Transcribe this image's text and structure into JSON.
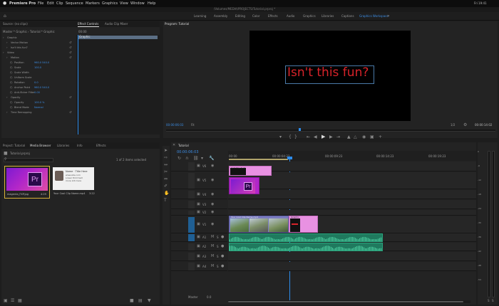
{
  "menubar": {
    "app_name": "Premiere Pro",
    "items": [
      "File",
      "Edit",
      "Clip",
      "Sequence",
      "Markers",
      "Graphics",
      "View",
      "Window",
      "Help"
    ],
    "status": "Fri 19:41"
  },
  "title_bar": {
    "path": "/Volumes/MEDIA/PROJECTS/Tutorial.prproj *"
  },
  "workspaces": [
    "Learning",
    "Assembly",
    "Editing",
    "Color",
    "Effects",
    "Audio",
    "Graphics",
    "Libraries",
    "Captions",
    "Graphics Workspace"
  ],
  "source_tabs": [
    "Source: (no clips)",
    "Effect Controls",
    "Audio Clip Mixer"
  ],
  "effect_controls": {
    "header": "Master * Graphic  ›  Tutorial * Graphic",
    "ruler_time": "00:00",
    "clip_bar": "Graphic",
    "rows": [
      {
        "label": "Graphic",
        "indent": 0,
        "value": ""
      },
      {
        "label": "Vector Motion",
        "indent": 1,
        "value": ""
      },
      {
        "label": "Isn't this fun?",
        "indent": 1,
        "value": ""
      },
      {
        "label": "Video",
        "indent": 0,
        "value": ""
      },
      {
        "label": "Motion",
        "indent": 1,
        "value": ""
      },
      {
        "label": "Position",
        "indent": 2,
        "value": "960.0   540.0"
      },
      {
        "label": "Scale",
        "indent": 2,
        "value": "100.0"
      },
      {
        "label": "Scale Width",
        "indent": 2,
        "value": ""
      },
      {
        "label": "Uniform Scale",
        "indent": 2,
        "value": ""
      },
      {
        "label": "Rotation",
        "indent": 2,
        "value": "0.0"
      },
      {
        "label": "Anchor Point",
        "indent": 2,
        "value": "960.0   540.0"
      },
      {
        "label": "Anti-flicker Filter",
        "indent": 2,
        "value": "0.00"
      },
      {
        "label": "Opacity",
        "indent": 1,
        "value": ""
      },
      {
        "label": "Opacity",
        "indent": 2,
        "value": "100.0 %"
      },
      {
        "label": "Blend Mode",
        "indent": 2,
        "value": "Normal"
      },
      {
        "label": "Time Remapping",
        "indent": 1,
        "value": ""
      }
    ],
    "timecode": "00:00:06:03"
  },
  "program": {
    "tab": "Program: Tutorial",
    "overlay_text": "Isn't this fun?",
    "timecode": "00:00:06:03",
    "fit": "Fit",
    "quality": "1/2",
    "duration": "00:00:14:02"
  },
  "project": {
    "tabs": [
      "Project: Tutorial",
      "Media Browser",
      "Libraries",
      "Info",
      "Effects"
    ],
    "bin": "Tutorial.prproj",
    "count": "1 of 2 items selected",
    "items": [
      {
        "name": "magenta_FXP.jpg",
        "duration": "4:29"
      },
      {
        "name": "Your Cool Clip Name.mp4",
        "duration": "3:22"
      }
    ],
    "thumb_text_lines": [
      "Name · Title Here",
      "www.site.com",
      "Lower third text",
      "more info here"
    ]
  },
  "timeline": {
    "tab": "Tutorial",
    "timecode": "00:00:06:03",
    "ruler": [
      "00:00",
      "00:00:04:23",
      "00:00:09:23",
      "00:00:14:23",
      "00:00:19:23"
    ],
    "v_tracks": [
      "V6",
      "V5",
      "V4",
      "V3",
      "V2",
      "V1"
    ],
    "a_tracks": [
      "A1",
      "A2",
      "A3",
      "A4"
    ],
    "master": "Master",
    "master_val": "0.0",
    "clips": {
      "title_clip": "Isn't this fun?",
      "image_clip": "magenta_FXP.jpg",
      "video_clip": "Your Cool Clip Name.mp4",
      "gfx_clip": "Graphic"
    }
  },
  "meter_scale": [
    "0",
    "-6",
    "-12",
    "-18",
    "-24",
    "-30",
    "-36",
    "-42",
    "-48",
    "-54"
  ],
  "colors": {
    "accent": "#2d8ceb",
    "overlay_text": "#d8232a",
    "clip_pink": "#e891e2",
    "clip_magenta": "#b126c9",
    "audio_green": "#28a57e"
  }
}
